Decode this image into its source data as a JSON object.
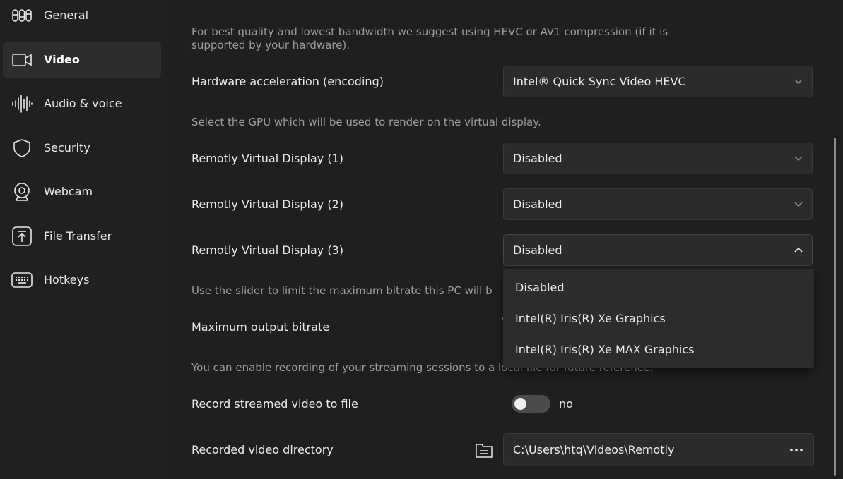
{
  "sidebar": {
    "items": [
      {
        "label": "General",
        "icon": "general-icon",
        "active": false
      },
      {
        "label": "Video",
        "icon": "video-camera-icon",
        "active": true
      },
      {
        "label": "Audio & voice",
        "icon": "audio-wave-icon",
        "active": false
      },
      {
        "label": "Security",
        "icon": "shield-icon",
        "active": false
      },
      {
        "label": "Webcam",
        "icon": "webcam-icon",
        "active": false
      },
      {
        "label": "File Transfer",
        "icon": "upload-icon",
        "active": false
      },
      {
        "label": "Hotkeys",
        "icon": "keyboard-icon",
        "active": false
      }
    ]
  },
  "main": {
    "compression_hint": "For best quality and lowest bandwidth we suggest using HEVC or AV1 compression (if it is supported by your hardware).",
    "hw_accel": {
      "label": "Hardware acceleration (encoding)",
      "value": "Intel® Quick Sync Video HEVC"
    },
    "gpu_hint": "Select the GPU which will be used to render on the virtual display.",
    "displays": [
      {
        "label": "Remotly Virtual Display (1)",
        "value": "Disabled"
      },
      {
        "label": "Remotly Virtual Display (2)",
        "value": "Disabled"
      },
      {
        "label": "Remotly Virtual Display (3)",
        "value": "Disabled"
      }
    ],
    "dropdown_options": [
      "Disabled",
      "Intel(R) Iris(R) Xe Graphics",
      "Intel(R) Iris(R) Xe MAX Graphics"
    ],
    "bitrate_hint": "Use the slider to limit the maximum bitrate this PC will b",
    "bitrate": {
      "label": "Maximum output bitrate"
    },
    "recording_hint": "You can enable recording of your streaming sessions to a local file for future reference.",
    "record": {
      "label": "Record streamed video to file",
      "state_text": "no",
      "enabled": false
    },
    "directory": {
      "label": "Recorded video directory",
      "value": "C:\\Users\\htq\\Videos\\Remotly"
    }
  },
  "colors": {
    "background": "#1f1f1f",
    "sidebar_active": "#2d2d2d",
    "field": "#2b2b2b",
    "slider_accent": "#4fb34f"
  }
}
